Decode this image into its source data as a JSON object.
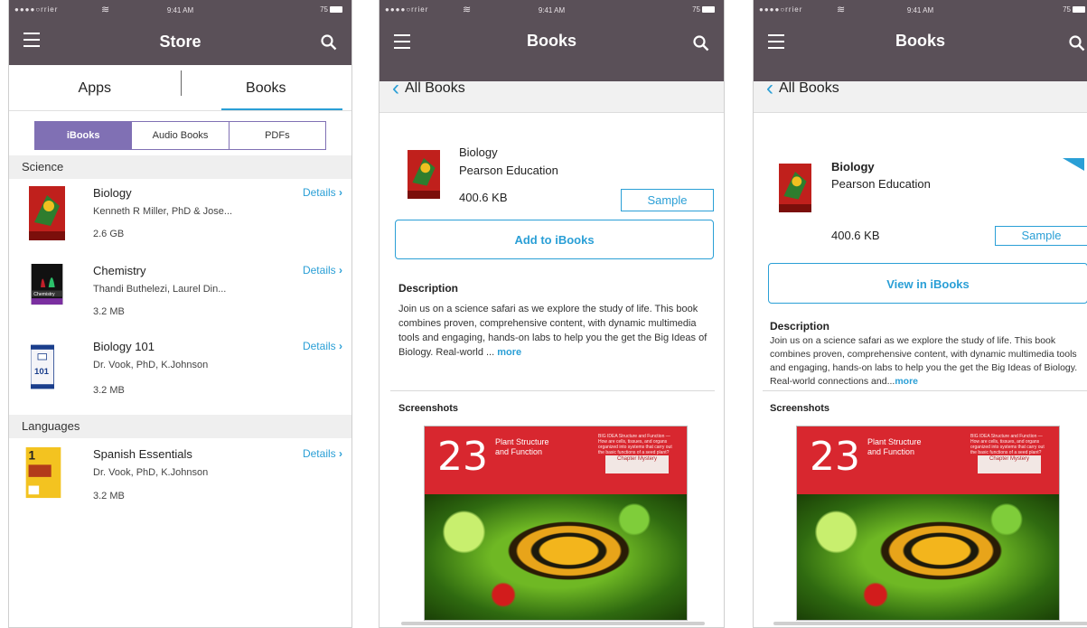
{
  "status": {
    "carrier": "●●●●○rrier",
    "time": "9:41 AM",
    "battery": "75"
  },
  "store": {
    "title": "Store",
    "tabs": [
      "Apps",
      "Books"
    ],
    "segments": [
      "iBooks",
      "Audio Books",
      "PDFs"
    ],
    "sections": [
      {
        "header": "Science",
        "books": [
          {
            "title": "Biology",
            "author": "Kenneth R Miller, PhD & Jose...",
            "size": "2.6 GB",
            "details": "Details"
          },
          {
            "title": "Chemistry",
            "author": "Thandi Buthelezi, Laurel Din...",
            "size": "3.2 MB",
            "details": "Details"
          },
          {
            "title": "Biology 101",
            "author": "Dr. Vook, PhD, K.Johnson",
            "size": "3.2 MB",
            "details": "Details"
          }
        ]
      },
      {
        "header": "Languages",
        "books": [
          {
            "title": "Spanish Essentials",
            "author": "Dr. Vook, PhD, K.Johnson",
            "size": "3.2 MB",
            "details": "Details"
          }
        ]
      }
    ]
  },
  "detail1": {
    "title": "Books",
    "back": "All Books",
    "book_title": "Biology",
    "publisher": "Pearson Education",
    "size": "400.6 KB",
    "sample": "Sample",
    "action": "Add to iBooks",
    "desc_title": "Description",
    "desc": "Join us on a science safari as we explore the study of life. This book combines proven, comprehensive content, with dynamic multimedia tools and engaging, hands-on labs to help you the get the Big Ideas of Biology. Real-world ...",
    "more": "more",
    "shots_title": "Screenshots"
  },
  "detail2": {
    "title": "Books",
    "back": "All Books",
    "book_title": "Biology",
    "publisher": "Pearson Education",
    "size": "400.6 KB",
    "sample": "Sample",
    "action": "View in iBooks",
    "desc_title": "Description",
    "desc": "Join us on a science safari as we explore the study of life. This book combines proven, comprehensive content, with dynamic multimedia tools and engaging, hands-on labs to help you the get the Big Ideas of Biology. Real-world connections and...",
    "more": "more",
    "shots_title": "Screenshots"
  },
  "screenshot": {
    "number": "23",
    "caption": "Plant Structure and Function",
    "side": "BIG IDEA Structure and Function — How are cells, tissues, and organs organized into systems that carry out the basic functions of a seed plant?",
    "mystery": "Chapter Mystery"
  },
  "colors": {
    "navbar": "#5a5058",
    "accent": "#2a9fd6",
    "segment": "#8070b4"
  }
}
